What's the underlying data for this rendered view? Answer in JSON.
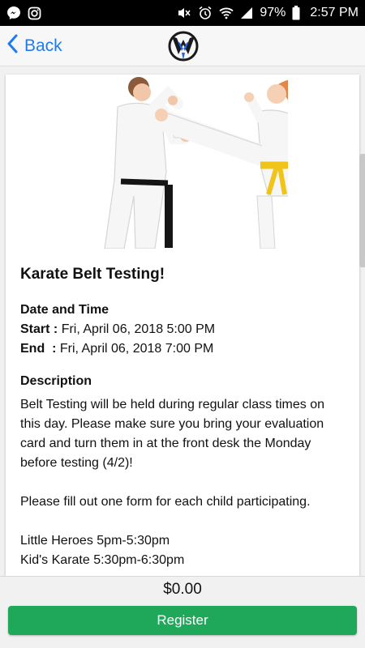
{
  "status_bar": {
    "battery": "97%",
    "time": "2:57 PM",
    "icons": [
      "messenger-icon",
      "instagram-icon",
      "mute-icon",
      "alarm-icon",
      "wifi-icon",
      "signal-icon",
      "battery-icon"
    ]
  },
  "nav": {
    "back_label": "Back",
    "accent": "#1e7cf0"
  },
  "event": {
    "title": "Karate Belt Testing!",
    "datetime_heading": "Date and Time",
    "start_label": "Start :",
    "start_value": "Fri, April 06, 2018 5:00 PM",
    "end_label": "End  :",
    "end_value": "Fri, April 06, 2018 7:00 PM",
    "description_heading": "Description",
    "description": "Belt Testing will be held during regular class times on this day. Please make sure you bring your evaluation card and turn them in at the front desk the Monday before testing (4/2)!\n\nPlease fill out one form for each child participating.\n\nLittle Heroes 5pm-5:30pm\nKid's Karate 5:30pm-6:30pm"
  },
  "footer": {
    "price": "$0.00",
    "register_label": "Register",
    "register_color": "#1fa85a"
  }
}
